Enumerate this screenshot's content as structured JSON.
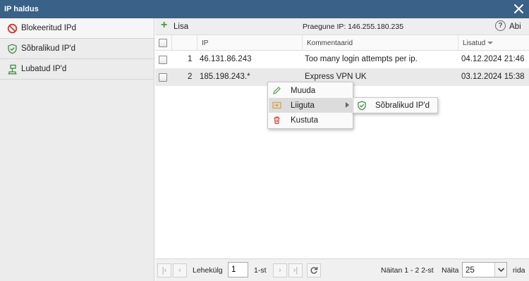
{
  "window": {
    "title": "IP haldus",
    "close_icon": "close-icon"
  },
  "sidebar": {
    "items": [
      {
        "label": "Blokeeritud IPd",
        "icon": "blocked-icon",
        "color": "#d9352a"
      },
      {
        "label": "Sõbralikud IP'd",
        "icon": "shield-check-icon",
        "color": "#3c8c3c"
      },
      {
        "label": "Lubatud IP'd",
        "icon": "network-icon",
        "color": "#3c8c3c"
      }
    ]
  },
  "toolbar": {
    "add_label": "Lisa",
    "current_ip": "Praegune IP: 146.255.180.235",
    "help_label": "Abi"
  },
  "grid": {
    "columns": [
      "IP",
      "Kommentaarid",
      "Lisatud"
    ],
    "rows": [
      {
        "num": "1",
        "ip": "46.131.86.243",
        "comment": "Too many login attempts per ip.",
        "added": "04.12.2024 21:46"
      },
      {
        "num": "2",
        "ip": "185.198.243.*",
        "comment": "Express VPN UK",
        "added": "03.12.2024 15:38"
      }
    ]
  },
  "context_menu": {
    "items": [
      {
        "label": "Muuda",
        "icon": "pencil-icon"
      },
      {
        "label": "Liiguta",
        "icon": "move-icon"
      },
      {
        "label": "Kustuta",
        "icon": "trash-icon"
      }
    ],
    "submenu": {
      "label": "Sõbralikud IP'd",
      "icon": "shield-check-icon"
    }
  },
  "pager": {
    "page_label": "Lehekülg",
    "page_value": "1",
    "of_label": "1-st",
    "showing": "Näitan 1 - 2 2-st",
    "show_label": "Näita",
    "page_size": "25",
    "rows_label": "rida"
  },
  "colors": {
    "titlebar": "#3a6288",
    "accent_green": "#3c8c3c",
    "accent_red": "#d9352a"
  }
}
